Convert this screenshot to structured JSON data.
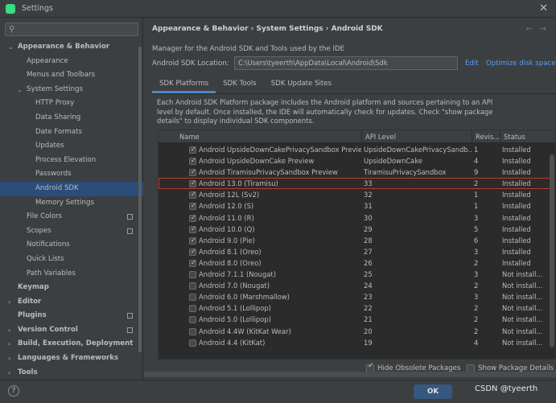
{
  "window": {
    "title": "Settings"
  },
  "sidebar": {
    "items": [
      {
        "label": "Appearance & Behavior",
        "level": 0,
        "bold": true,
        "arrow": "expanded"
      },
      {
        "label": "Appearance",
        "level": 1
      },
      {
        "label": "Menus and Toolbars",
        "level": 1
      },
      {
        "label": "System Settings",
        "level": 1,
        "arrow": "expanded"
      },
      {
        "label": "HTTP Proxy",
        "level": 2
      },
      {
        "label": "Data Sharing",
        "level": 2
      },
      {
        "label": "Date Formats",
        "level": 2
      },
      {
        "label": "Updates",
        "level": 2
      },
      {
        "label": "Process Elevation",
        "level": 2
      },
      {
        "label": "Passwords",
        "level": 2
      },
      {
        "label": "Android SDK",
        "level": 2,
        "selected": true
      },
      {
        "label": "Memory Settings",
        "level": 2
      },
      {
        "label": "File Colors",
        "level": 1,
        "square": true
      },
      {
        "label": "Scopes",
        "level": 1,
        "square": true
      },
      {
        "label": "Notifications",
        "level": 1
      },
      {
        "label": "Quick Lists",
        "level": 1
      },
      {
        "label": "Path Variables",
        "level": 1
      },
      {
        "label": "Keymap",
        "level": 0,
        "bold": true
      },
      {
        "label": "Editor",
        "level": 0,
        "bold": true,
        "arrow": "collapsed"
      },
      {
        "label": "Plugins",
        "level": 0,
        "bold": true,
        "square": true
      },
      {
        "label": "Version Control",
        "level": 0,
        "bold": true,
        "arrow": "collapsed",
        "square": true
      },
      {
        "label": "Build, Execution, Deployment",
        "level": 0,
        "bold": true,
        "arrow": "collapsed"
      },
      {
        "label": "Languages & Frameworks",
        "level": 0,
        "bold": true,
        "arrow": "collapsed"
      },
      {
        "label": "Tools",
        "level": 0,
        "bold": true,
        "arrow": "collapsed"
      }
    ]
  },
  "breadcrumb": [
    "Appearance & Behavior",
    "System Settings",
    "Android SDK"
  ],
  "description": "Manager for the Android SDK and Tools used by the IDE",
  "location": {
    "label": "Android SDK Location:",
    "value": "C:\\Users\\tyeerth\\AppData\\Local\\Android\\Sdk",
    "edit": "Edit",
    "optimize": "Optimize disk space"
  },
  "tabs": [
    {
      "label": "SDK Platforms",
      "active": true
    },
    {
      "label": "SDK Tools",
      "active": false
    },
    {
      "label": "SDK Update Sites",
      "active": false
    }
  ],
  "info": "Each Android SDK Platform package includes the Android platform and sources pertaining to an API level by default. Once installed, the IDE will automatically check for updates. Check \"show package details\" to display individual SDK components.",
  "table": {
    "headers": {
      "name": "Name",
      "api": "API Level",
      "revision": "Revis...",
      "status": "Status"
    },
    "rows": [
      {
        "checked": true,
        "name": "Android UpsideDownCakePrivacySandbox Preview",
        "api": "UpsideDownCakePrivacySandb...",
        "rev": "1",
        "status": "Installed"
      },
      {
        "checked": true,
        "name": "Android UpsideDownCake Preview",
        "api": "UpsideDownCake",
        "rev": "4",
        "status": "Installed"
      },
      {
        "checked": true,
        "name": "Android TiramisuPrivacySandbox Preview",
        "api": "TiramisuPrivacySandbox",
        "rev": "9",
        "status": "Installed"
      },
      {
        "checked": true,
        "name": "Android 13.0 (Tiramisu)",
        "api": "33",
        "rev": "2",
        "status": "Installed",
        "highlight": true
      },
      {
        "checked": true,
        "name": "Android 12L (Sv2)",
        "api": "32",
        "rev": "1",
        "status": "Installed"
      },
      {
        "checked": true,
        "name": "Android 12.0 (S)",
        "api": "31",
        "rev": "1",
        "status": "Installed"
      },
      {
        "checked": true,
        "name": "Android 11.0 (R)",
        "api": "30",
        "rev": "3",
        "status": "Installed"
      },
      {
        "checked": true,
        "name": "Android 10.0 (Q)",
        "api": "29",
        "rev": "5",
        "status": "Installed"
      },
      {
        "checked": true,
        "name": "Android 9.0 (Pie)",
        "api": "28",
        "rev": "6",
        "status": "Installed"
      },
      {
        "checked": true,
        "name": "Android 8.1 (Oreo)",
        "api": "27",
        "rev": "3",
        "status": "Installed"
      },
      {
        "checked": true,
        "name": "Android 8.0 (Oreo)",
        "api": "26",
        "rev": "2",
        "status": "Installed"
      },
      {
        "checked": false,
        "name": "Android 7.1.1 (Nougat)",
        "api": "25",
        "rev": "3",
        "status": "Not install..."
      },
      {
        "checked": false,
        "name": "Android 7.0 (Nougat)",
        "api": "24",
        "rev": "2",
        "status": "Not install..."
      },
      {
        "checked": false,
        "name": "Android 6.0 (Marshmallow)",
        "api": "23",
        "rev": "3",
        "status": "Not install..."
      },
      {
        "checked": false,
        "name": "Android 5.1 (Lollipop)",
        "api": "22",
        "rev": "2",
        "status": "Not install..."
      },
      {
        "checked": false,
        "name": "Android 5.0 (Lollipop)",
        "api": "21",
        "rev": "2",
        "status": "Not install..."
      },
      {
        "checked": false,
        "name": "Android 4.4W (KitKat Wear)",
        "api": "20",
        "rev": "2",
        "status": "Not install..."
      },
      {
        "checked": false,
        "name": "Android 4.4 (KitKat)",
        "api": "19",
        "rev": "4",
        "status": "Not install..."
      }
    ]
  },
  "options": {
    "hide_obsolete": {
      "label": "Hide Obsolete Packages",
      "checked": true
    },
    "show_details": {
      "label": "Show Package Details",
      "checked": false
    }
  },
  "footer": {
    "help": "?",
    "ok": "OK",
    "watermark": "CSDN @tyeerth"
  },
  "colors": {
    "accent": "#589df6",
    "selection": "#2a4d7a",
    "highlight_border": "#c0392b",
    "ok_button": "#365880"
  }
}
